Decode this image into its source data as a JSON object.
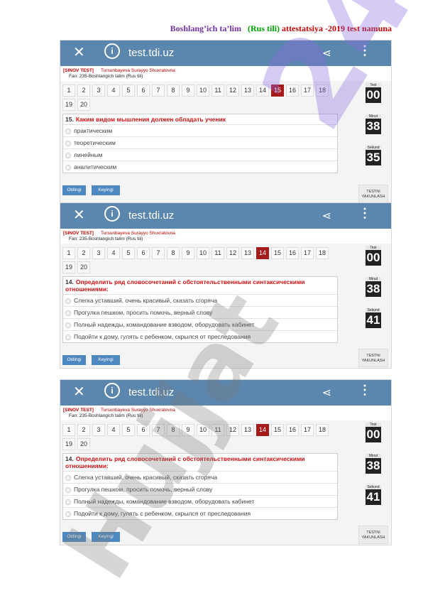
{
  "doc": {
    "part1": "Boshlang’ich ta’lim",
    "part2": "(Rus tili)",
    "part3": "attestatsiya -2019 test namuna"
  },
  "app": {
    "url": "test.tdi.uz",
    "close_glyph": "✕",
    "info_glyph": "i",
    "share_glyph": "⋖",
    "more_glyph": "⋮"
  },
  "labels": {
    "test": "Test",
    "minut": "Minut",
    "sekund": "Sekund",
    "oldingi": "Oldingi",
    "keyingi": "Keyingi",
    "end_line1": "TESTNI",
    "end_line2": "YAKUNLASH"
  },
  "screens": [
    {
      "sinov": "[SINOV TEST]",
      "person": "Tursunbayeva Surayyo Shuxratovna",
      "fan": "Fan:  235-Boshlangich talim (Rus tili)",
      "pages": [
        "1",
        "2",
        "3",
        "4",
        "5",
        "6",
        "7",
        "8",
        "9",
        "10",
        "11",
        "12",
        "13",
        "14",
        "15",
        "16",
        "17",
        "18",
        "19",
        "20"
      ],
      "active": "15",
      "qnum": "15.",
      "qtext": "Каким видом мышления должен обладать ученик",
      "options": [
        "практическим",
        "теоретическим",
        "линейным",
        "аналитическим"
      ],
      "timer": {
        "test": "00",
        "minut": "38",
        "sekund": "35"
      }
    },
    {
      "sinov": "[SINOV TEST]",
      "person": "Tursunbayeva Surayyo Shuxratovna",
      "fan": "Fan:  235-Boshlangich talim (Rus tili)",
      "pages": [
        "1",
        "2",
        "3",
        "4",
        "5",
        "6",
        "7",
        "8",
        "9",
        "10",
        "11",
        "12",
        "13",
        "14",
        "15",
        "16",
        "17",
        "18",
        "19",
        "20"
      ],
      "active": "14",
      "qnum": "14.",
      "qtext": "Определить ряд словосочетаний с обстоятельственными синтаксическими отношениями:",
      "options": [
        "Слегка уставший, очень красивый, сказать сгоряча",
        "Прогулка пешком, просить помочь, верный слову",
        "Полный надежды, командование взводом, оборудовать кабинет",
        "Подойти к дому, гулять с ребенком, скрылся от преследования"
      ],
      "timer": {
        "test": "00",
        "minut": "38",
        "sekund": "41"
      }
    },
    {
      "sinov": "[SINOV TEST]",
      "person": "Tursunbayeva Surayyo Shuxratovna",
      "fan": "Fan:  235-Boshlangich talim (Rus tili)",
      "pages": [
        "1",
        "2",
        "3",
        "4",
        "5",
        "6",
        "7",
        "8",
        "9",
        "10",
        "11",
        "12",
        "13",
        "14",
        "15",
        "16",
        "17",
        "18",
        "19",
        "20"
      ],
      "active": "14",
      "qnum": "14.",
      "qtext": "Определить ряд словосочетаний с обстоятельственными синтаксическими отношениями:",
      "options": [
        "Слегка уставший, очень красивый, сказать сгоряча",
        "Прогулка пешком, просить помочь, верный слову",
        "Полный надежды, командование взводом, оборудовать кабинет",
        "Подойти к дому, гулять с ребенком, скрылся от преследования"
      ],
      "timer": {
        "test": "00",
        "minut": "38",
        "sekund": "41"
      }
    }
  ],
  "watermark": {
    "w1": "24",
    "w2": "Hujjat",
    "color1": "#8a6de0",
    "color2": "#7a7a7a"
  },
  "colors": {
    "header": "#5b86ad",
    "active_page": "#a51b1b",
    "question": "#d01010",
    "button": "#4d89c0"
  }
}
